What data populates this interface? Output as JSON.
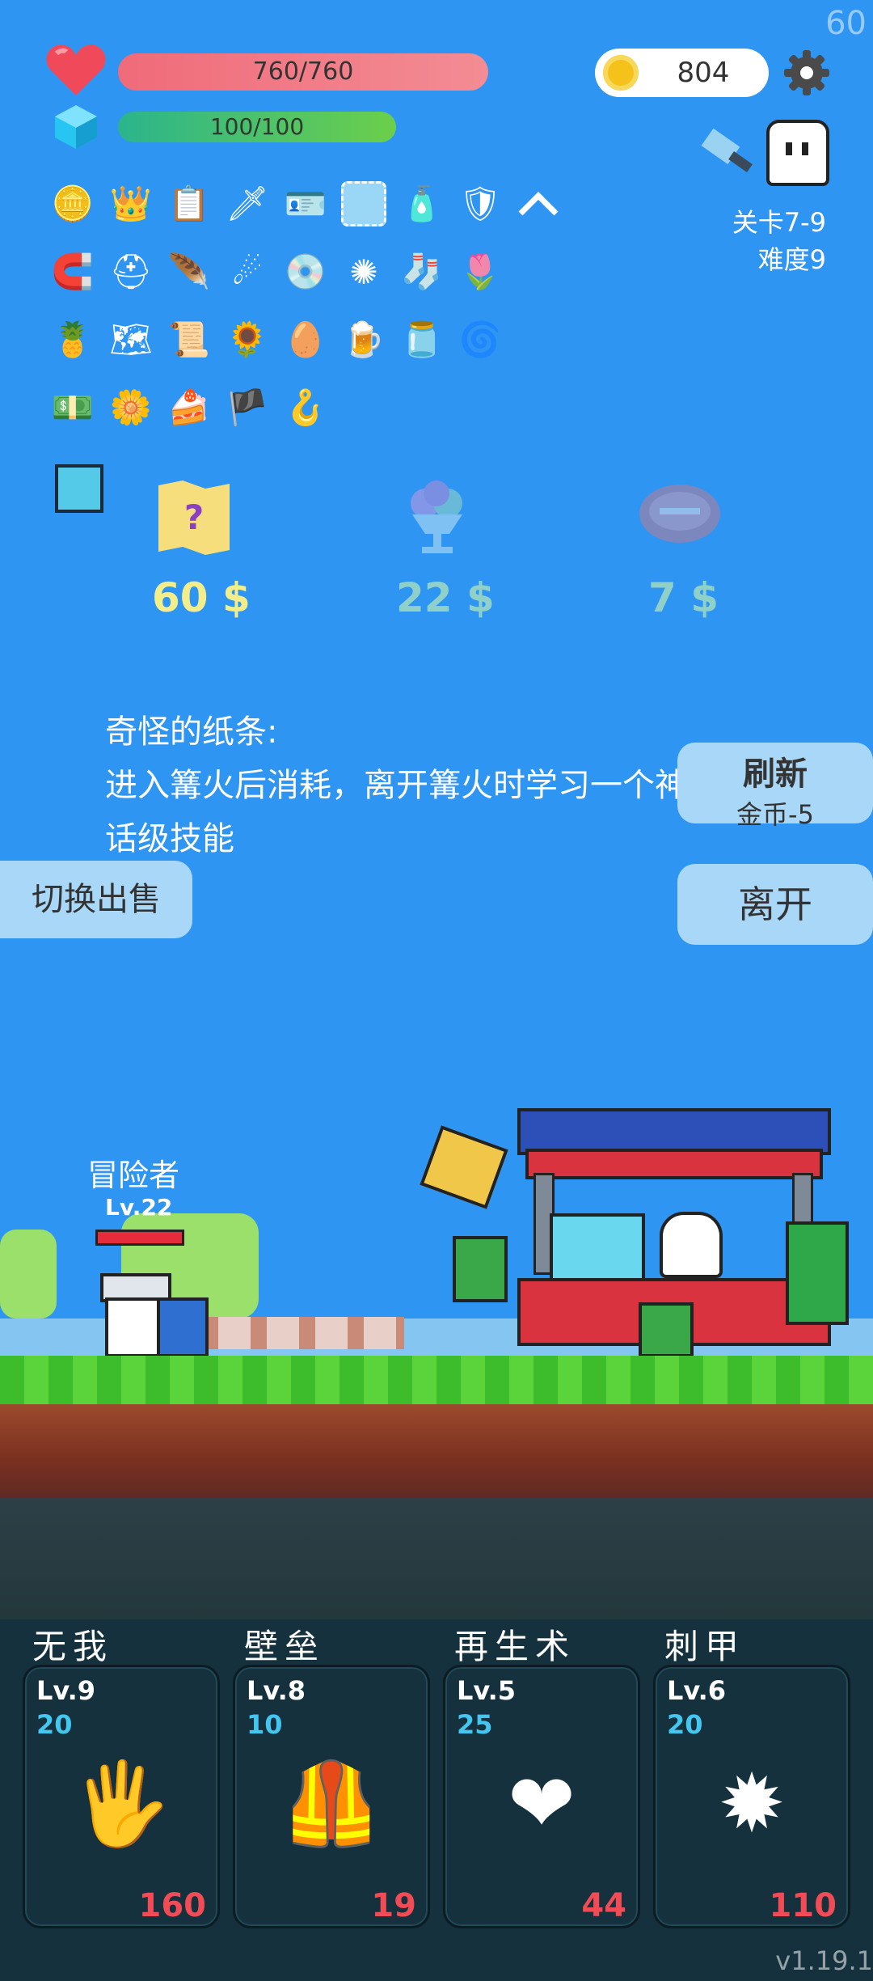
{
  "fps": "60",
  "hud": {
    "hp": "760/760",
    "mp": "100/100",
    "coins": "804",
    "stage": "关卡7-9",
    "difficulty": "难度9"
  },
  "inventory_icons": [
    [
      "coin-stack-icon",
      "crown-icon",
      "list-icon",
      "sword-icon",
      "star-card-icon",
      "blank-card-icon",
      "spray-bottle-icon",
      "shield-icon",
      "chevron-up-icon"
    ],
    [
      "magnet-icon",
      "helmet-icon",
      "feather-quill-icon",
      "meteor-icon",
      "ring-disc-icon",
      "gem-cluster-icon",
      "sock-icon",
      "flower-pot-icon"
    ],
    [
      "pineapple-icon",
      "treasure-map-icon",
      "map-x-icon",
      "sunflower-icon",
      "golden-egg-icon",
      "beer-mug-icon",
      "jam-jar-icon",
      "spiral-portal-icon"
    ],
    [
      "money-heart-icon",
      "daisy-icon",
      "cake-flag-icon",
      "pirate-ship-icon",
      "hook-icon"
    ]
  ],
  "shop": {
    "items": [
      {
        "name": "map-question-icon",
        "price": "60 $",
        "color": "#f4ee8a"
      },
      {
        "name": "ice-cream-icon",
        "price": "22 $",
        "color": "#8fd1c9"
      },
      {
        "name": "steak-icon",
        "price": "7 $",
        "color": "#8fd1c9"
      }
    ],
    "description_title": "奇怪的纸条:",
    "description_body": "进入篝火后消耗，离开篝火时学习一个神话级技能",
    "refresh_label": "刷新",
    "refresh_cost": "金币-5",
    "leave_label": "离开",
    "switch_label": "切换出售"
  },
  "player": {
    "name": "冒险者",
    "level": "Lv.22"
  },
  "skills": [
    {
      "name": "无我",
      "level": "Lv.9",
      "cost": "20",
      "value": "160",
      "icon": "eye-hand-icon"
    },
    {
      "name": "壁垒",
      "level": "Lv.8",
      "cost": "10",
      "value": "19",
      "icon": "armor-icon"
    },
    {
      "name": "再生术",
      "level": "Lv.5",
      "cost": "25",
      "value": "44",
      "icon": "winged-heart-icon"
    },
    {
      "name": "刺甲",
      "level": "Lv.6",
      "cost": "20",
      "value": "110",
      "icon": "spiked-mace-icon"
    }
  ],
  "version": "v1.19.1",
  "colors": {
    "sky": "#2f95f2",
    "hp": "#f06b7a",
    "mp": "#2bb48c",
    "cost": "#43c6f0",
    "damage": "#f14b55"
  }
}
